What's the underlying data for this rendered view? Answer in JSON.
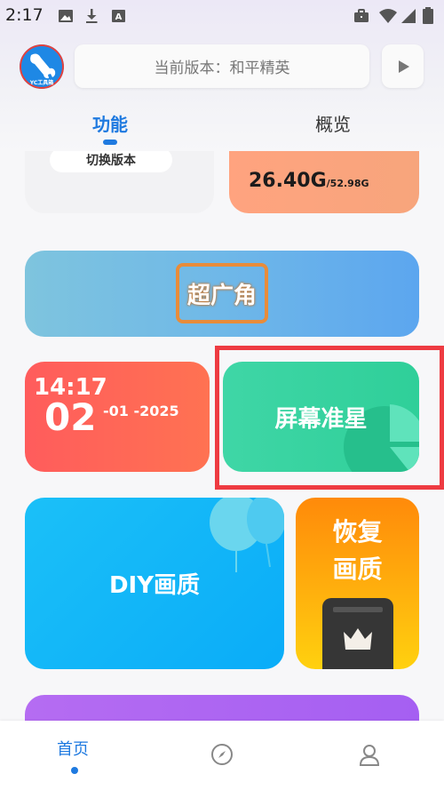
{
  "status_bar": {
    "time": "2:17",
    "left_icons": [
      "image-icon",
      "download-icon",
      "text-recognition-icon"
    ],
    "right_icons": [
      "briefcase-icon",
      "wifi-icon",
      "signal-icon",
      "battery-icon"
    ]
  },
  "header": {
    "logo_caption": "YC工具箱",
    "version_label": "当前版本：和平精英",
    "play_icon": "play-icon"
  },
  "tabs": [
    {
      "label": "功能",
      "active": true
    },
    {
      "label": "概览",
      "active": false
    }
  ],
  "cards": {
    "switch_version": {
      "label": "切换版本"
    },
    "storage": {
      "used": "26.40G",
      "total": "/52.98G",
      "color": "#ffa37f"
    },
    "wide_angle": {
      "label": "超广角",
      "color": "#6fb8e8"
    },
    "datetime": {
      "time": "14:17",
      "day": "02",
      "rest": "-01 -2025",
      "color": "#ff6456"
    },
    "crosshair": {
      "label": "屏幕准星",
      "color": "#36d2a0"
    },
    "diy_quality": {
      "label": "DIY画质",
      "color": "#14b6f8"
    },
    "restore_quality": {
      "line1": "恢复",
      "line2": "画质",
      "color": "#ff9d0c"
    }
  },
  "highlight_color": "#ee3b42",
  "bottom_nav": {
    "home_label": "首页",
    "active_color": "#1f7ae0",
    "items": [
      "home",
      "compass-icon",
      "profile-icon"
    ]
  }
}
